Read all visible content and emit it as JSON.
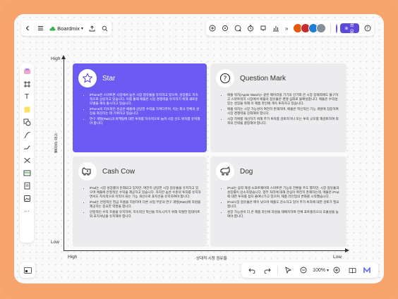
{
  "app": {
    "name": "Boardmix"
  },
  "toolbar": {
    "share_label": "공유",
    "zoom": "100%"
  },
  "icons": {
    "back": "chevron-left-icon",
    "menu": "hamburger-menu-icon",
    "export": "export-icon",
    "search": "search-icon",
    "add": "add-icon",
    "ai": "ai-icon",
    "comment": "comment-icon",
    "timer": "timer-icon",
    "present": "present-icon",
    "chart": "chart-icon",
    "more": "more-icon",
    "help": "help-icon"
  },
  "matrix": {
    "y_axis": {
      "high": "High",
      "low": "Low",
      "label": "시장 성장률"
    },
    "x_axis": {
      "high": "High",
      "low": "Low",
      "label": "상대적 시장 점유율"
    },
    "quadrants": [
      {
        "key": "star",
        "title": "Star",
        "icon": "star-icon",
        "items": [
          "iPhone은 스마트폰 시장에서 높은 시장 점유율을 유지하고 있으며, 성장률도 지속적으로 상승하고 있습니다. 이를 통해 애플은 시장 경쟁력을 유지하기 위해 새로운 모델을 계속 출시하고 있습니다.",
          "iPhone의 지속적인 성공은 애플에 상당한 수익을 가져다주며, 이는 회사 전체의 성장을 촉진하는 데 기여하고 있습니다.",
          "연구 개발(R&D)과 마케팅에 대한 투자를 지속적으로 늘려 시장 선도 위치를 유지해야 합니다."
        ]
      },
      {
        "key": "question",
        "title": "Question Mark",
        "icon": "question-mark-icon",
        "items": [
          "애플 워치(Apple Watch)+ 같은 웨어러블 기기의 인기와 큰 시장 잠재력에도 불구하고 스마트워치 시장에서 애플의 점유율은 경쟁 심화로 불확실합니다. 애플은 수익성 있는 성장을 위해 이 제품 라인에 계속 투자하고 있습니다.",
          "애플 워치는 시장 가능성이 여전히 존재하며, 애플은 혁신적인 기능 개발에 집중하여 시장 경쟁력을 강화해야 합니다.",
          "시장 지위를 개선하기 위해 추가 투자를 검토하거나 또는 투자 규모를 재검토하여 최적의 전략을 결정해야 합니다."
        ]
      },
      {
        "key": "cashcow",
        "title": "Cash Cow",
        "icon": "cow-icon",
        "items": [
          "iPad는 시장 성장률이 둔화되고 있지만, 여전히 상당한 시장 점유율을 유지하고 있으며 애플에 안정적인 수익을 제공하고 있습니다. 하지만 높은 수준의 투자를 유지하면서도 지속적으로 이익이 되는 기능 개선으로 포지션을 유지하여야 합니다.",
          "iPad는 안정적인 현금 흐름을 지원하며 다른 사업 부문의 연구 개발(R&D)에 자원을 제공하는 중요한 역할을 합니다.",
          "안정적인 수익 흐름을 유지하며, 지속적인 혁신을 지속시키기 위해 적절한 업데이트와 포지셔닝을 유지해야 합니다."
        ]
      },
      {
        "key": "dog",
        "title": "Dog",
        "icon": "dog-icon",
        "items": [
          "iPod는 음악 재생 소프트웨어와 스마트폰 기능의 전환을 주도 했지만, 시장 점유율과 성장률이 감소하였습니다. 업무 처리에 대해 관심이 여전히 존재하는데, 애플은 iPod에 대한 투자를 점차 줄여나가고 있으며, 제품 라인업의 변화를 시작했습니다.",
          "iPod시장 점유율은 매우 낮으며 매출도 감소하고 있어 추가 투자에 대한 검토가 필요합니다.",
          "성장 가능성이 더 큰 제품 라인에 자원을 재배치하여 전체 포트폴리오의 효율성을 높여야 합니다."
        ]
      }
    ]
  }
}
